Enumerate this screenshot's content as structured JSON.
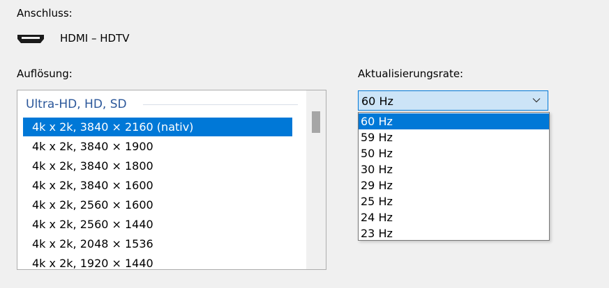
{
  "connection": {
    "label": "Anschluss:",
    "icon": "hdmi-port-icon",
    "value": "HDMI – HDTV"
  },
  "resolution": {
    "label": "Auflösung:",
    "group_header": "Ultra-HD, HD, SD",
    "selected_index": 0,
    "items": [
      "4k x 2k, 3840 × 2160 (nativ)",
      "4k x 2k, 3840 × 1900",
      "4k x 2k, 3840 × 1800",
      "4k x 2k, 3840 × 1600",
      "4k x 2k, 2560 × 1600",
      "4k x 2k, 2560 × 1440",
      "4k x 2k, 2048 × 1536",
      "4k x 2k, 1920 × 1440"
    ]
  },
  "refresh_rate": {
    "label": "Aktualisierungsrate:",
    "current_value": "60 Hz",
    "selected_index": 0,
    "options": [
      "60 Hz",
      "59 Hz",
      "50 Hz",
      "30 Hz",
      "29 Hz",
      "25 Hz",
      "24 Hz",
      "23 Hz"
    ]
  },
  "colors": {
    "selection": "#0078d7",
    "group_header": "#2b579a",
    "combo_background": "#cce4f7",
    "window_background": "#f0f0f0"
  }
}
